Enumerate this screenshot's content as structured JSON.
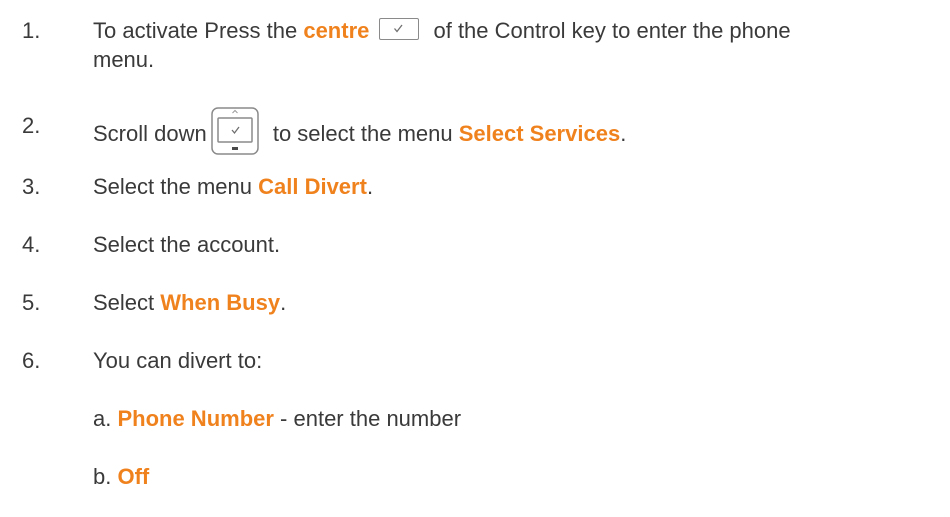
{
  "steps": [
    {
      "num": "1.",
      "pre": "To activate Press the ",
      "hl": "centre",
      "post": " of the Control key to enter the phone",
      "line2": "menu."
    },
    {
      "num": "2.",
      "pre": "Scroll down",
      "post": " to select the menu ",
      "hl": "Select Services",
      "end": "."
    },
    {
      "num": "3.",
      "pre": "Select the menu ",
      "hl": "Call Divert",
      "end": "."
    },
    {
      "num": "4.",
      "pre": "Select the account."
    },
    {
      "num": "5.",
      "pre": "Select ",
      "hl": "When Busy",
      "end": "."
    },
    {
      "num": "6.",
      "pre": "You can divert to:"
    }
  ],
  "options": [
    {
      "prefix": "a. ",
      "hl": "Phone Number",
      "post": " - enter the number"
    },
    {
      "prefix": "b. ",
      "hl": "Off"
    }
  ],
  "icons": {
    "small_key": "control-key-centre-icon",
    "big_key": "control-key-scroll-icon"
  },
  "colors": {
    "highlight": "#f0821e",
    "text": "#3a3a3a"
  }
}
